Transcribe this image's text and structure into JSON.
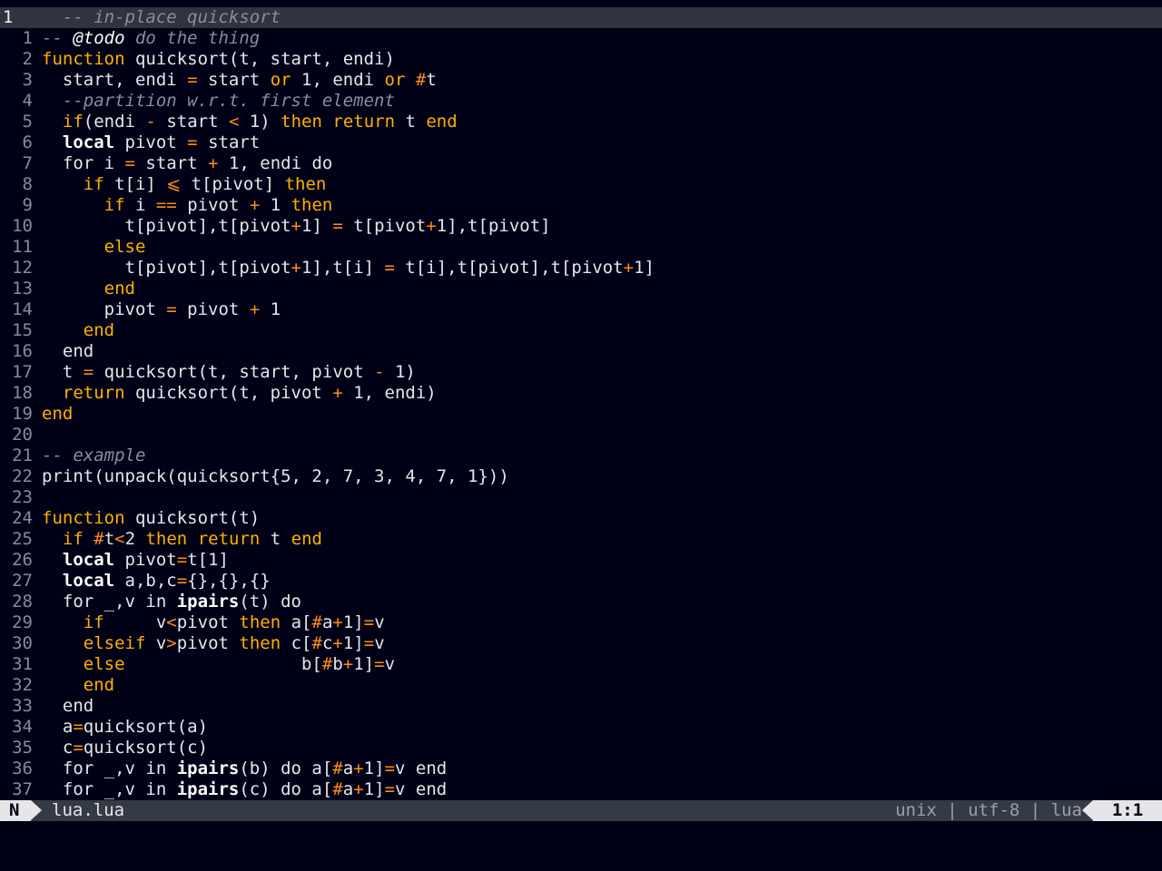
{
  "editor": {
    "lines": [
      {
        "num": "1",
        "current": true,
        "tokens": [
          {
            "t": "  -- in-place quicksort",
            "c": "cm"
          }
        ]
      },
      {
        "num": "1",
        "tokens": [
          {
            "t": "-- ",
            "c": "cm"
          },
          {
            "t": "@todo",
            "c": "tag"
          },
          {
            "t": " do the thing",
            "c": "cm"
          }
        ]
      },
      {
        "num": "2",
        "tokens": [
          {
            "t": "function",
            "c": "kw"
          },
          {
            "t": " quicksort(t, start, endi)",
            "c": "id"
          }
        ]
      },
      {
        "num": "3",
        "tokens": [
          {
            "t": "  start, endi ",
            "c": "id"
          },
          {
            "t": "=",
            "c": "op"
          },
          {
            "t": " start ",
            "c": "id"
          },
          {
            "t": "or",
            "c": "kw"
          },
          {
            "t": " 1, endi ",
            "c": "id"
          },
          {
            "t": "or",
            "c": "kw"
          },
          {
            "t": " ",
            "c": "id"
          },
          {
            "t": "#",
            "c": "op"
          },
          {
            "t": "t",
            "c": "id"
          }
        ]
      },
      {
        "num": "4",
        "tokens": [
          {
            "t": "  --partition w.r.t. first element",
            "c": "cm"
          }
        ]
      },
      {
        "num": "5",
        "tokens": [
          {
            "t": "  ",
            "c": "id"
          },
          {
            "t": "if",
            "c": "kw"
          },
          {
            "t": "(endi ",
            "c": "id"
          },
          {
            "t": "-",
            "c": "op"
          },
          {
            "t": " start ",
            "c": "id"
          },
          {
            "t": "<",
            "c": "op"
          },
          {
            "t": " 1) ",
            "c": "id"
          },
          {
            "t": "then",
            "c": "kw"
          },
          {
            "t": " ",
            "c": "id"
          },
          {
            "t": "return",
            "c": "kw"
          },
          {
            "t": " t ",
            "c": "id"
          },
          {
            "t": "end",
            "c": "kw"
          }
        ]
      },
      {
        "num": "6",
        "tokens": [
          {
            "t": "  ",
            "c": "id"
          },
          {
            "t": "local",
            "c": "kw2"
          },
          {
            "t": " pivot ",
            "c": "id"
          },
          {
            "t": "=",
            "c": "op"
          },
          {
            "t": " start",
            "c": "id"
          }
        ]
      },
      {
        "num": "7",
        "tokens": [
          {
            "t": "  for i ",
            "c": "id"
          },
          {
            "t": "=",
            "c": "op"
          },
          {
            "t": " start ",
            "c": "id"
          },
          {
            "t": "+",
            "c": "op"
          },
          {
            "t": " 1, endi do",
            "c": "id"
          }
        ]
      },
      {
        "num": "8",
        "tokens": [
          {
            "t": "    ",
            "c": "id"
          },
          {
            "t": "if",
            "c": "kw"
          },
          {
            "t": " t[i] ",
            "c": "id"
          },
          {
            "t": "⩽",
            "c": "op"
          },
          {
            "t": " t[pivot] ",
            "c": "id"
          },
          {
            "t": "then",
            "c": "kw"
          }
        ]
      },
      {
        "num": "9",
        "tokens": [
          {
            "t": "      ",
            "c": "id"
          },
          {
            "t": "if",
            "c": "kw"
          },
          {
            "t": " i ",
            "c": "id"
          },
          {
            "t": "==",
            "c": "op"
          },
          {
            "t": " pivot ",
            "c": "id"
          },
          {
            "t": "+",
            "c": "op"
          },
          {
            "t": " 1 ",
            "c": "id"
          },
          {
            "t": "then",
            "c": "kw"
          }
        ]
      },
      {
        "num": "10",
        "tokens": [
          {
            "t": "        t[pivot],t[pivot",
            "c": "id"
          },
          {
            "t": "+",
            "c": "op"
          },
          {
            "t": "1] ",
            "c": "id"
          },
          {
            "t": "=",
            "c": "op"
          },
          {
            "t": " t[pivot",
            "c": "id"
          },
          {
            "t": "+",
            "c": "op"
          },
          {
            "t": "1],t[pivot]",
            "c": "id"
          }
        ]
      },
      {
        "num": "11",
        "tokens": [
          {
            "t": "      ",
            "c": "id"
          },
          {
            "t": "else",
            "c": "kw"
          }
        ]
      },
      {
        "num": "12",
        "tokens": [
          {
            "t": "        t[pivot],t[pivot",
            "c": "id"
          },
          {
            "t": "+",
            "c": "op"
          },
          {
            "t": "1],t[i] ",
            "c": "id"
          },
          {
            "t": "=",
            "c": "op"
          },
          {
            "t": " t[i],t[pivot],t[pivot",
            "c": "id"
          },
          {
            "t": "+",
            "c": "op"
          },
          {
            "t": "1]",
            "c": "id"
          }
        ]
      },
      {
        "num": "13",
        "tokens": [
          {
            "t": "      ",
            "c": "id"
          },
          {
            "t": "end",
            "c": "kw"
          }
        ]
      },
      {
        "num": "14",
        "tokens": [
          {
            "t": "      pivot ",
            "c": "id"
          },
          {
            "t": "=",
            "c": "op"
          },
          {
            "t": " pivot ",
            "c": "id"
          },
          {
            "t": "+",
            "c": "op"
          },
          {
            "t": " 1",
            "c": "id"
          }
        ]
      },
      {
        "num": "15",
        "tokens": [
          {
            "t": "    ",
            "c": "id"
          },
          {
            "t": "end",
            "c": "kw"
          }
        ]
      },
      {
        "num": "16",
        "tokens": [
          {
            "t": "  end",
            "c": "id"
          }
        ]
      },
      {
        "num": "17",
        "tokens": [
          {
            "t": "  t ",
            "c": "id"
          },
          {
            "t": "=",
            "c": "op"
          },
          {
            "t": " quicksort(t, start, pivot ",
            "c": "id"
          },
          {
            "t": "-",
            "c": "op"
          },
          {
            "t": " 1)",
            "c": "id"
          }
        ]
      },
      {
        "num": "18",
        "tokens": [
          {
            "t": "  ",
            "c": "id"
          },
          {
            "t": "return",
            "c": "kw"
          },
          {
            "t": " quicksort(t, pivot ",
            "c": "id"
          },
          {
            "t": "+",
            "c": "op"
          },
          {
            "t": " 1, endi)",
            "c": "id"
          }
        ]
      },
      {
        "num": "19",
        "tokens": [
          {
            "t": "end",
            "c": "kw"
          }
        ]
      },
      {
        "num": "20",
        "tokens": []
      },
      {
        "num": "21",
        "tokens": [
          {
            "t": "-- example",
            "c": "cm"
          }
        ]
      },
      {
        "num": "22",
        "tokens": [
          {
            "t": "print(unpack(quicksort{5, 2, 7, 3, 4, 7, 1}))",
            "c": "id"
          }
        ]
      },
      {
        "num": "23",
        "tokens": []
      },
      {
        "num": "24",
        "tokens": [
          {
            "t": "function",
            "c": "kw"
          },
          {
            "t": " quicksort(t)",
            "c": "id"
          }
        ]
      },
      {
        "num": "25",
        "tokens": [
          {
            "t": "  ",
            "c": "id"
          },
          {
            "t": "if",
            "c": "kw"
          },
          {
            "t": " ",
            "c": "id"
          },
          {
            "t": "#",
            "c": "op"
          },
          {
            "t": "t",
            "c": "id"
          },
          {
            "t": "<",
            "c": "op"
          },
          {
            "t": "2 ",
            "c": "id"
          },
          {
            "t": "then",
            "c": "kw"
          },
          {
            "t": " ",
            "c": "id"
          },
          {
            "t": "return",
            "c": "kw"
          },
          {
            "t": " t ",
            "c": "id"
          },
          {
            "t": "end",
            "c": "kw"
          }
        ]
      },
      {
        "num": "26",
        "tokens": [
          {
            "t": "  ",
            "c": "id"
          },
          {
            "t": "local",
            "c": "kw2"
          },
          {
            "t": " pivot",
            "c": "id"
          },
          {
            "t": "=",
            "c": "op"
          },
          {
            "t": "t[1]",
            "c": "id"
          }
        ]
      },
      {
        "num": "27",
        "tokens": [
          {
            "t": "  ",
            "c": "id"
          },
          {
            "t": "local",
            "c": "kw2"
          },
          {
            "t": " a,b,c",
            "c": "id"
          },
          {
            "t": "=",
            "c": "op"
          },
          {
            "t": "{},{},{}",
            "c": "id"
          }
        ]
      },
      {
        "num": "28",
        "tokens": [
          {
            "t": "  for _,v in ",
            "c": "id"
          },
          {
            "t": "ipairs",
            "c": "kw2"
          },
          {
            "t": "(t) do",
            "c": "id"
          }
        ]
      },
      {
        "num": "29",
        "tokens": [
          {
            "t": "    ",
            "c": "id"
          },
          {
            "t": "if",
            "c": "kw"
          },
          {
            "t": "     v",
            "c": "id"
          },
          {
            "t": "<",
            "c": "op"
          },
          {
            "t": "pivot ",
            "c": "id"
          },
          {
            "t": "then",
            "c": "kw"
          },
          {
            "t": " a[",
            "c": "id"
          },
          {
            "t": "#",
            "c": "op"
          },
          {
            "t": "a",
            "c": "id"
          },
          {
            "t": "+",
            "c": "op"
          },
          {
            "t": "1]",
            "c": "id"
          },
          {
            "t": "=",
            "c": "op"
          },
          {
            "t": "v",
            "c": "id"
          }
        ]
      },
      {
        "num": "30",
        "tokens": [
          {
            "t": "    ",
            "c": "id"
          },
          {
            "t": "elseif",
            "c": "kw"
          },
          {
            "t": " v",
            "c": "id"
          },
          {
            "t": ">",
            "c": "op"
          },
          {
            "t": "pivot ",
            "c": "id"
          },
          {
            "t": "then",
            "c": "kw"
          },
          {
            "t": " c[",
            "c": "id"
          },
          {
            "t": "#",
            "c": "op"
          },
          {
            "t": "c",
            "c": "id"
          },
          {
            "t": "+",
            "c": "op"
          },
          {
            "t": "1]",
            "c": "id"
          },
          {
            "t": "=",
            "c": "op"
          },
          {
            "t": "v",
            "c": "id"
          }
        ]
      },
      {
        "num": "31",
        "tokens": [
          {
            "t": "    ",
            "c": "id"
          },
          {
            "t": "else",
            "c": "kw"
          },
          {
            "t": "                 b[",
            "c": "id"
          },
          {
            "t": "#",
            "c": "op"
          },
          {
            "t": "b",
            "c": "id"
          },
          {
            "t": "+",
            "c": "op"
          },
          {
            "t": "1]",
            "c": "id"
          },
          {
            "t": "=",
            "c": "op"
          },
          {
            "t": "v",
            "c": "id"
          }
        ]
      },
      {
        "num": "32",
        "tokens": [
          {
            "t": "    ",
            "c": "id"
          },
          {
            "t": "end",
            "c": "kw"
          }
        ]
      },
      {
        "num": "33",
        "tokens": [
          {
            "t": "  end",
            "c": "id"
          }
        ]
      },
      {
        "num": "34",
        "tokens": [
          {
            "t": "  a",
            "c": "id"
          },
          {
            "t": "=",
            "c": "op"
          },
          {
            "t": "quicksort(a)",
            "c": "id"
          }
        ]
      },
      {
        "num": "35",
        "tokens": [
          {
            "t": "  c",
            "c": "id"
          },
          {
            "t": "=",
            "c": "op"
          },
          {
            "t": "quicksort(c)",
            "c": "id"
          }
        ]
      },
      {
        "num": "36",
        "tokens": [
          {
            "t": "  for _,v in ",
            "c": "id"
          },
          {
            "t": "ipairs",
            "c": "kw2"
          },
          {
            "t": "(b) do a[",
            "c": "id"
          },
          {
            "t": "#",
            "c": "op"
          },
          {
            "t": "a",
            "c": "id"
          },
          {
            "t": "+",
            "c": "op"
          },
          {
            "t": "1]",
            "c": "id"
          },
          {
            "t": "=",
            "c": "op"
          },
          {
            "t": "v end",
            "c": "id"
          }
        ]
      },
      {
        "num": "37",
        "tokens": [
          {
            "t": "  for _,v in ",
            "c": "id"
          },
          {
            "t": "ipairs",
            "c": "kw2"
          },
          {
            "t": "(c) do a[",
            "c": "id"
          },
          {
            "t": "#",
            "c": "op"
          },
          {
            "t": "a",
            "c": "id"
          },
          {
            "t": "+",
            "c": "op"
          },
          {
            "t": "1]",
            "c": "id"
          },
          {
            "t": "=",
            "c": "op"
          },
          {
            "t": "v end",
            "c": "id"
          }
        ]
      }
    ]
  },
  "statusline": {
    "mode": "N",
    "filename": "lua.lua",
    "fileinfo": "unix | utf-8 | lua",
    "position": "1:1"
  },
  "colors": {
    "background": "#000016",
    "keyword": "#ffb000",
    "operator": "#ff8c1a",
    "comment": "#8c8c9a",
    "statusline_bg": "#353b45",
    "cursorline_bg": "#2e3440"
  }
}
